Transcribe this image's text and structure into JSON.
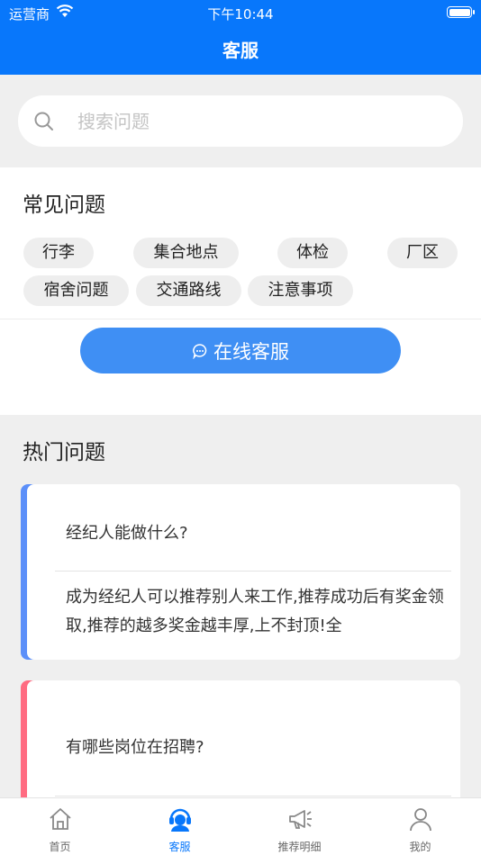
{
  "status": {
    "carrier": "运营商",
    "time": "下午10:44"
  },
  "header": {
    "title": "客服"
  },
  "search": {
    "placeholder": "搜索问题"
  },
  "faq": {
    "title": "常见问题",
    "tags": [
      "行李",
      "集合地点",
      "体检",
      "厂区",
      "宿舍问题",
      "交通路线",
      "注意事项"
    ],
    "service_button": "在线客服"
  },
  "hot": {
    "title": "热门问题",
    "cards": [
      {
        "question": "经纪人能做什么?",
        "answer": "成为经纪人可以推荐别人来工作,推荐成功后有奖金领取,推荐的越多奖金越丰厚,上不封顶!全",
        "accent": "#5b8ff9"
      },
      {
        "question": "有哪些岗位在招聘?",
        "answer": "",
        "accent": "#ff6b81"
      }
    ]
  },
  "tabbar": {
    "items": [
      {
        "label": "首页",
        "icon": "home-icon"
      },
      {
        "label": "客服",
        "icon": "customer-service-icon",
        "active": true
      },
      {
        "label": "推荐明细",
        "icon": "megaphone-icon"
      },
      {
        "label": "我的",
        "icon": "person-icon"
      }
    ]
  },
  "colors": {
    "primary": "#0877fb",
    "button": "#3f8ff4"
  }
}
